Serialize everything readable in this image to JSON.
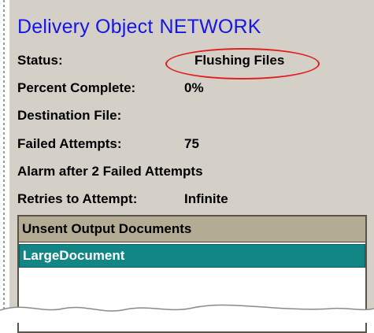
{
  "title": {
    "prefix": "Delivery Object",
    "name": "NETWORK"
  },
  "fields": {
    "status": {
      "label": "Status:",
      "value": "Flushing Files"
    },
    "percent_complete": {
      "label": "Percent Complete:",
      "value": "0%"
    },
    "destination_file": {
      "label": "Destination File:",
      "value": ""
    },
    "failed_attempts": {
      "label": "Failed Attempts:",
      "value": "75"
    },
    "alarm": {
      "text": "Alarm after 2 Failed Attempts"
    },
    "retries": {
      "label": "Retries to Attempt:",
      "value": "Infinite"
    }
  },
  "unsent_list": {
    "header": "Unsent Output Documents",
    "items": [
      "LargeDocument"
    ]
  },
  "colors": {
    "panel_bg": "#d4d0c8",
    "title": "#1515e6",
    "highlight_ellipse": "#e02020",
    "list_header_bg": "#b3ab93",
    "selected_row_bg": "#128585"
  }
}
